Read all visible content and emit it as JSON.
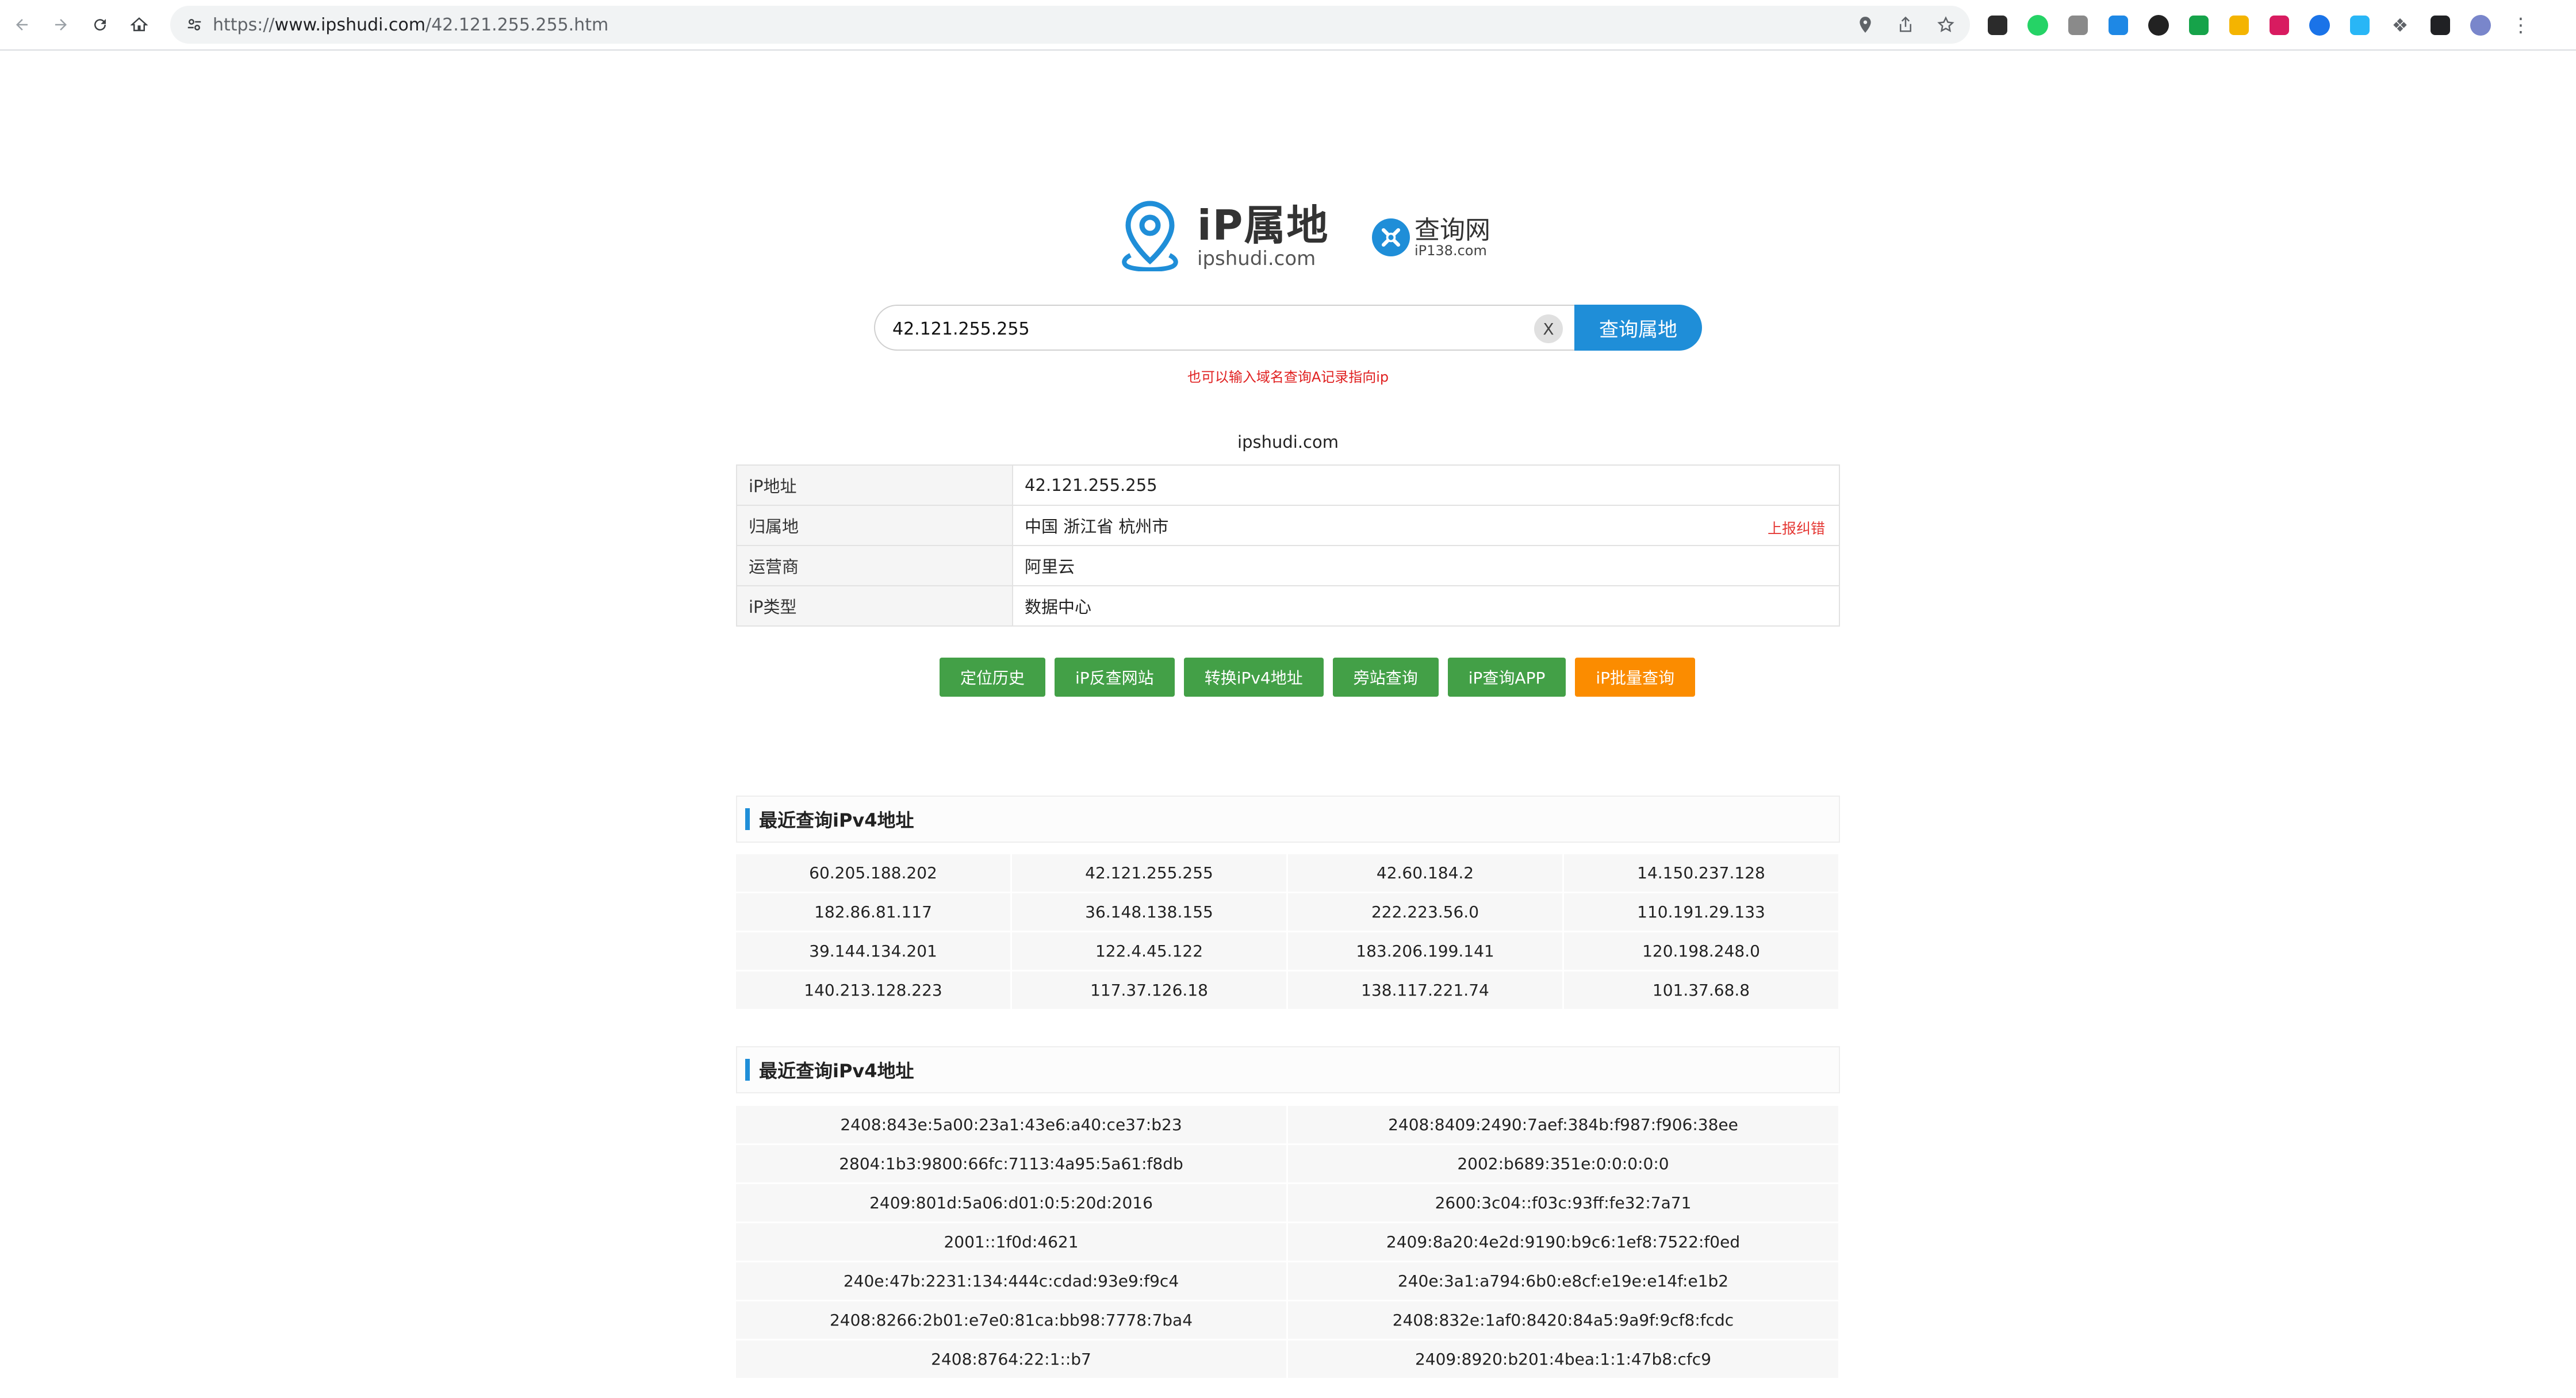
{
  "browser": {
    "url_scheme": "https://",
    "url_host": "www.ipshudi.com",
    "url_path": "/42.121.255.255.htm",
    "nav_icons": [
      "back-icon",
      "forward-icon",
      "reload-icon",
      "home-icon"
    ],
    "extensions": [
      {
        "name": "x-extension-icon",
        "color": "#2b2b2b"
      },
      {
        "name": "whatsapp-extension-icon",
        "color": "#25d366"
      },
      {
        "name": "camera-extension-icon",
        "color": "#8a8a8a"
      },
      {
        "name": "translate-extension-icon",
        "color": "#1e88e5"
      },
      {
        "name": "red-badge-extension-icon",
        "color": "#222222"
      },
      {
        "name": "green-square-extension-icon",
        "color": "#16a34a"
      },
      {
        "name": "yellow-extension-icon",
        "color": "#f4b400"
      },
      {
        "name": "pink-extension-icon",
        "color": "#d81b60"
      },
      {
        "name": "blue-circle-extension-icon",
        "color": "#1a73e8"
      },
      {
        "name": "bird-extension-icon",
        "color": "#29b6f6"
      },
      {
        "name": "puzzle-extension-icon",
        "color": "#5f6368"
      },
      {
        "name": "sidepanel-icon",
        "color": "#202124"
      },
      {
        "name": "profile-avatar-icon",
        "color": "#7986cb"
      },
      {
        "name": "menu-dots-icon",
        "color": "#5f6368"
      }
    ]
  },
  "logo": {
    "title": "iP属地",
    "subtitle": "ipshudi.com",
    "partner_title": "查询网",
    "partner_subtitle": "iP138.com"
  },
  "search": {
    "value": "42.121.255.255",
    "clear_label": "X",
    "button_label": "查询属地",
    "hint": "也可以输入域名查询A记录指向ip"
  },
  "site_label": "ipshudi.com",
  "info": {
    "rows": [
      {
        "key": "iP地址",
        "value": "42.121.255.255"
      },
      {
        "key": "归属地",
        "value": "中国 浙江省 杭州市",
        "action": "上报纠错"
      },
      {
        "key": "运营商",
        "value": "阿里云"
      },
      {
        "key": "iP类型",
        "value": "数据中心"
      }
    ]
  },
  "actions": [
    {
      "label": "定位历史",
      "color": "#43a047"
    },
    {
      "label": "iP反查网站",
      "color": "#43a047"
    },
    {
      "label": "转换iPv4地址",
      "color": "#43a047"
    },
    {
      "label": "旁站查询",
      "color": "#43a047"
    },
    {
      "label": "iP查询APP",
      "color": "#43a047"
    },
    {
      "label": "iP批量查询",
      "color": "#fb8c00"
    }
  ],
  "recent_v4": {
    "title": "最近查询iPv4地址",
    "items": [
      "60.205.188.202",
      "42.121.255.255",
      "42.60.184.2",
      "14.150.237.128",
      "182.86.81.117",
      "36.148.138.155",
      "222.223.56.0",
      "110.191.29.133",
      "39.144.134.201",
      "122.4.45.122",
      "183.206.199.141",
      "120.198.248.0",
      "140.213.128.223",
      "117.37.126.18",
      "138.117.221.74",
      "101.37.68.8"
    ]
  },
  "recent_v6": {
    "title": "最近查询iPv4地址",
    "items": [
      "2408:843e:5a00:23a1:43e6:a40:ce37:b23",
      "2408:8409:2490:7aef:384b:f987:f906:38ee",
      "2804:1b3:9800:66fc:7113:4a95:5a61:f8db",
      "2002:b689:351e:0:0:0:0:0",
      "2409:801d:5a06:d01:0:5:20d:2016",
      "2600:3c04::f03c:93ff:fe32:7a71",
      "2001::1f0d:4621",
      "2409:8a20:4e2d:9190:b9c6:1ef8:7522:f0ed",
      "240e:47b:2231:134:444c:cdad:93e9:f9c4",
      "240e:3a1:a794:6b0:e8cf:e19e:e14f:e1b2",
      "2408:8266:2b01:e7e0:81ca:bb98:7778:7ba4",
      "2408:832e:1af0:8420:84a5:9a9f:9cf8:fcdc",
      "2408:8764:22:1::b7",
      "2409:8920:b201:4bea:1:1:47b8:cfc9"
    ]
  },
  "colors": {
    "accent": "#1f8ed8",
    "green_button": "#43a047",
    "orange_button": "#fb8c00",
    "error_text": "#e53935"
  }
}
